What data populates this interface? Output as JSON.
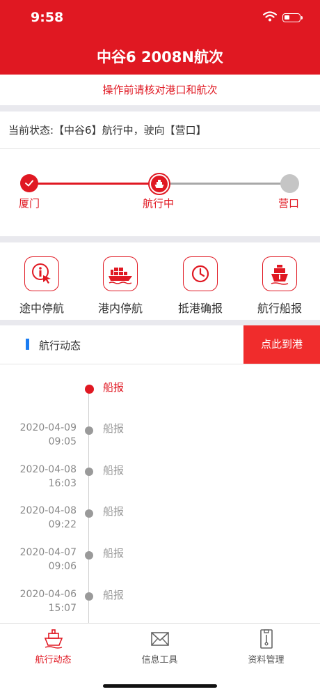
{
  "status_bar": {
    "time": "9:58",
    "battery_level": 0.35
  },
  "header": {
    "title": "中谷6  2008N航次",
    "notice": "操作前请核对港口和航次"
  },
  "current_status": "当前状态:【中谷6】航行中，驶向【营口】",
  "progress": {
    "steps": [
      {
        "label": "厦门",
        "state": "done"
      },
      {
        "label": "航行中",
        "state": "current"
      },
      {
        "label": "营口",
        "state": "pending"
      }
    ]
  },
  "actions": [
    {
      "label": "途中停航",
      "icon": "touch-info-icon"
    },
    {
      "label": "港内停航",
      "icon": "cargo-ship-icon"
    },
    {
      "label": "抵港确报",
      "icon": "clock-icon"
    },
    {
      "label": "航行船报",
      "icon": "ship-front-icon"
    }
  ],
  "section": {
    "title": "航行动态",
    "button": "点此到港"
  },
  "timeline": [
    {
      "date": "",
      "time": "",
      "label": "船报",
      "active": true
    },
    {
      "date": "2020-04-09",
      "time": "09:05",
      "label": "船报",
      "active": false
    },
    {
      "date": "2020-04-08",
      "time": "16:03",
      "label": "船报",
      "active": false
    },
    {
      "date": "2020-04-08",
      "time": "09:22",
      "label": "船报",
      "active": false
    },
    {
      "date": "2020-04-07",
      "time": "09:06",
      "label": "船报",
      "active": false
    },
    {
      "date": "2020-04-06",
      "time": "15:07",
      "label": "船报",
      "active": false
    }
  ],
  "tabs": [
    {
      "label": "航行动态",
      "icon": "ship-icon",
      "active": true
    },
    {
      "label": "信息工具",
      "icon": "mail-icon",
      "active": false
    },
    {
      "label": "资料管理",
      "icon": "document-icon",
      "active": false
    }
  ],
  "colors": {
    "primary": "#e01822",
    "accent_blue": "#1a7cf2",
    "inactive": "#9a9a9a"
  }
}
